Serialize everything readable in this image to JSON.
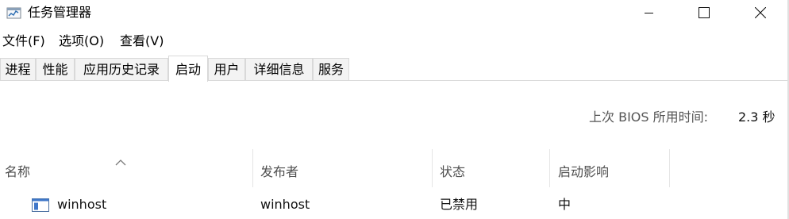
{
  "window": {
    "title": "任务管理器",
    "app_icon": "task-manager-icon"
  },
  "menu": [
    "文件(F)",
    "选项(O)",
    "查看(V)"
  ],
  "tabs": [
    "进程",
    "性能",
    "应用历史记录",
    "启动",
    "用户",
    "详细信息",
    "服务"
  ],
  "active_tab": "启动",
  "bios": {
    "label": "上次 BIOS 所用时间:",
    "value": "2.3 秒"
  },
  "table": {
    "columns": [
      "名称",
      "发布者",
      "状态",
      "启动影响"
    ],
    "sorted_column": "名称",
    "rows": [
      {
        "icon": "app-window-icon",
        "name": "winhost",
        "publisher": "winhost",
        "status": "已禁用",
        "impact": "中"
      }
    ]
  }
}
